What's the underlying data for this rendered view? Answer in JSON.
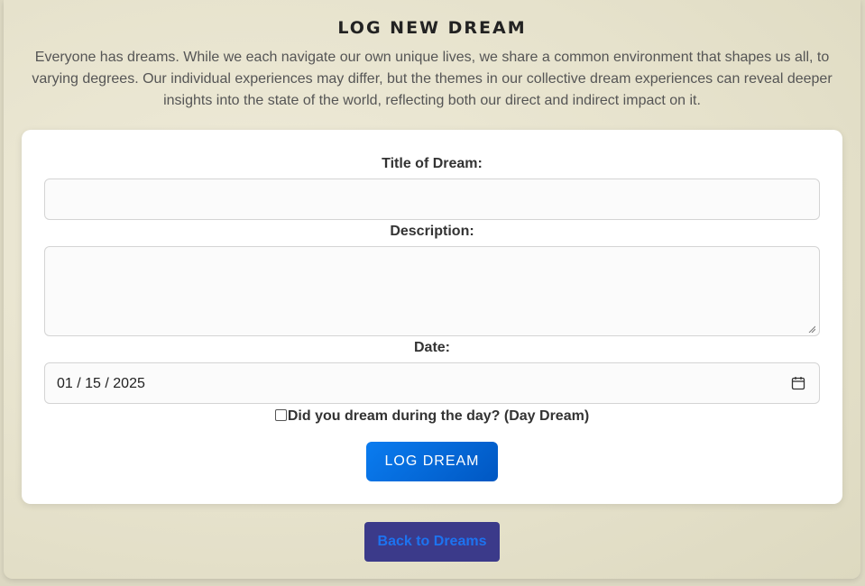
{
  "header": {
    "title": "LOG NEW DREAM",
    "intro": "Everyone has dreams. While we each navigate our own unique lives, we share a common environment that shapes us all, to varying degrees. Our individual experiences may differ, but the themes in our collective dream experiences can reveal deeper insights into the state of the world, reflecting both our direct and indirect impact on it."
  },
  "form": {
    "title_label": "Title of Dream:",
    "title_value": "",
    "description_label": "Description:",
    "description_value": "",
    "date_label": "Date:",
    "date_value": "01 / 15 / 2025",
    "daydream_label": "Did you dream during the day? (Day Dream)",
    "daydream_checked": false,
    "submit_label": "LOG DREAM"
  },
  "footer": {
    "back_label": "Back to Dreams"
  },
  "icons": {
    "date_picker": "calendar-icon",
    "textarea_resize": "resize-grip-icon"
  },
  "colors": {
    "primary_button": "#0a6fe0",
    "back_button_bg": "#3b3a8a",
    "back_button_text": "#1d73f0"
  }
}
